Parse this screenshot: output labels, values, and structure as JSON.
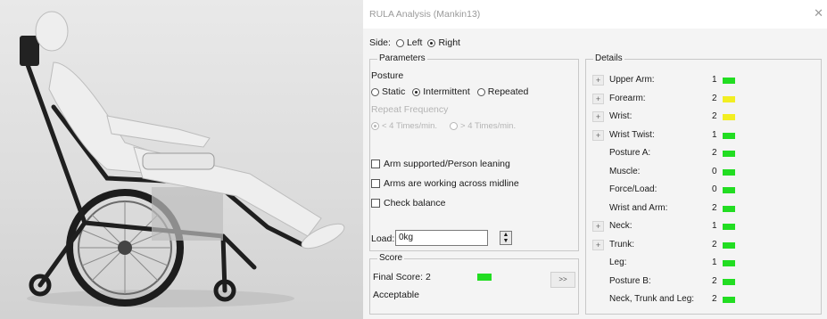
{
  "window": {
    "title": "RULA Analysis (Mankin13)",
    "close_glyph": "✕"
  },
  "side": {
    "label": "Side:",
    "options": [
      "Left",
      "Right"
    ],
    "selected": "Right"
  },
  "parameters": {
    "group_title": "Parameters",
    "posture_label": "Posture",
    "posture_options": [
      "Static",
      "Intermittent",
      "Repeated"
    ],
    "posture_selected": "Intermittent",
    "repeat_label": "Repeat Frequency",
    "repeat_options": [
      "< 4 Times/min.",
      "> 4 Times/min."
    ],
    "checkboxes": [
      {
        "label": "Arm supported/Person leaning",
        "checked": false
      },
      {
        "label": "Arms are working across midline",
        "checked": false
      },
      {
        "label": "Check balance",
        "checked": false
      }
    ],
    "load_label": "Load:",
    "load_value": "0kg"
  },
  "score": {
    "group_title": "Score",
    "final_score": "Final Score: 2",
    "verdict": "Acceptable",
    "final_color": "#22dd22",
    "more_button": ">>"
  },
  "details": {
    "group_title": "Details",
    "rows": [
      {
        "label": "Upper Arm:",
        "value": "1",
        "color": "#22dd22",
        "expand": "+"
      },
      {
        "label": "Forearm:",
        "value": "2",
        "color": "#f2ee22",
        "expand": "+"
      },
      {
        "label": "Wrist:",
        "value": "2",
        "color": "#f2ee22",
        "expand": "+"
      },
      {
        "label": "Wrist Twist:",
        "value": "1",
        "color": "#22dd22",
        "expand": "+"
      },
      {
        "label": "Posture A:",
        "value": "2",
        "color": "#22dd22"
      },
      {
        "label": "Muscle:",
        "value": "0",
        "color": "#22dd22"
      },
      {
        "label": "Force/Load:",
        "value": "0",
        "color": "#22dd22"
      },
      {
        "label": "Wrist and Arm:",
        "value": "2",
        "color": "#22dd22"
      },
      {
        "label": "Neck:",
        "value": "1",
        "color": "#22dd22",
        "expand": "+"
      },
      {
        "label": "Trunk:",
        "value": "2",
        "color": "#22dd22",
        "expand": "+"
      },
      {
        "label": "Leg:",
        "value": "1",
        "color": "#22dd22"
      },
      {
        "label": "Posture B:",
        "value": "2",
        "color": "#22dd22"
      },
      {
        "label": "Neck, Trunk and Leg:",
        "value": "2",
        "color": "#22dd22"
      }
    ]
  }
}
